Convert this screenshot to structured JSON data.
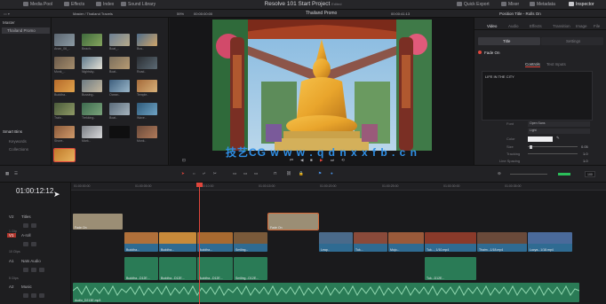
{
  "app": {
    "project_title": "Resolve 101 Start Project",
    "edited_badge": "Edited"
  },
  "top_menu": {
    "left": [
      "Media Pool",
      "Effects",
      "Index",
      "Sound Library"
    ],
    "right": [
      "Quick Export",
      "Mixer",
      "Metadata",
      "Inspector"
    ]
  },
  "media_pool": {
    "bin_path": "Master / Thailand Travels",
    "sidebar_master": "Master",
    "sidebar_bin": "Thailand Promo",
    "smart_bins_header": "Smart Bins",
    "smart_bins_items": [
      "Keywords",
      "Collections"
    ],
    "clip_labels": [
      "Anan_06_..",
      "Beach..",
      "Boat_..",
      "Bus..",
      "Monk_..",
      "Nightsky..",
      "Boat..",
      "Road..",
      "Buddha..",
      "Bussing..",
      "Ocean..",
      "Temple..",
      "Train..",
      "Trekking..",
      "Boat..",
      "Wave..",
      "Shore..",
      "Mark..",
      "Monk.."
    ]
  },
  "viewer": {
    "clip_label": "Thailand Promo",
    "zoom": "59%",
    "timecode_left": "00:00:00:00",
    "timecode_right": "00:00:41:13",
    "sequence_label": "Timeline 1"
  },
  "watermark": "技艺CG  w w w . q d n x x f b . c n",
  "inspector": {
    "header": "Position Title - Rolls On",
    "tabs": [
      "Video",
      "Audio",
      "Effects",
      "Transition",
      "Image",
      "File"
    ],
    "subtabs": [
      "Title",
      "Settings"
    ],
    "section_title": "Fade On",
    "text_tabs": [
      "Controls",
      "Text Inputs"
    ],
    "text_content": "LIFE IN THE CITY",
    "props": [
      {
        "label": "Font",
        "value": "Open Sans"
      },
      {
        "label": "",
        "value": "Light"
      },
      {
        "label": "Color",
        "value": ""
      },
      {
        "label": "Size",
        "value": "0.05"
      },
      {
        "label": "Tracking",
        "value": "1.0"
      },
      {
        "label": "Line Spacing",
        "value": "1.0"
      }
    ]
  },
  "timeline": {
    "current_timecode": "01:00:12:12",
    "ruler": [
      "01:00:00:00",
      "01:00:05:00",
      "01:00:10:00",
      "01:00:15:00",
      "01:00:20:00",
      "01:00:25:00",
      "01:00:30:00",
      "01:00:35:00"
    ],
    "tracks": [
      {
        "id": "V2",
        "name": "Titles",
        "sub": "1 Clip"
      },
      {
        "id": "V1",
        "name": "A-roll",
        "sub": "10 Clips"
      },
      {
        "id": "A1",
        "name": "Nats Audio",
        "sub": "5 Clips"
      },
      {
        "id": "A2",
        "name": "Music",
        "sub": "1 Clip"
      }
    ],
    "title_clips": [
      "Fade On",
      "Fade On"
    ],
    "video_clips": [
      "Buddha...",
      "Buddha...",
      "Buddha...",
      "Smiling...",
      "Leap..",
      "Tuk...",
      "Mojo...",
      "Tuk..., 1/10.mp4",
      "Thaim...1/18.mp4",
      "Lucya...1/18.mp4"
    ],
    "audio_clips": [
      "Buddha...D12E...",
      "Buddha...D12E...",
      "Buddha...D12E...",
      "Smiling...D12E...",
      "Tuk...D12E..."
    ],
    "music_clip": "Audio_D213E.mp3",
    "zoom_value": "100"
  },
  "colors": {
    "accent_red": "#e0463c",
    "video_clip": "#2f6b92",
    "audio_clip": "#2a7b56",
    "title_clip": "#9b8e75"
  }
}
